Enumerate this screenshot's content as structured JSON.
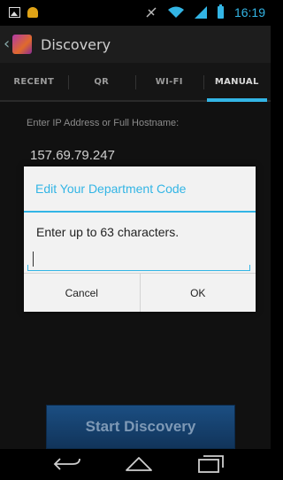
{
  "status_bar": {
    "time": "16:19",
    "icons": [
      "image-icon",
      "android-icon",
      "no-sync-icon",
      "wifi-icon",
      "signal-icon",
      "battery-icon"
    ],
    "accent_color": "#33b5e5"
  },
  "action_bar": {
    "title": "Discovery"
  },
  "tabs": [
    {
      "label": "RECENT",
      "active": false
    },
    {
      "label": "QR",
      "active": false
    },
    {
      "label": "WI-FI",
      "active": false
    },
    {
      "label": "MANUAL",
      "active": true
    }
  ],
  "manual": {
    "ip_label": "Enter IP Address or Full Hostname:",
    "ip_value": "157.69.79.247",
    "start_button": "Start Discovery"
  },
  "dialog": {
    "title": "Edit Your Department Code",
    "message": "Enter up to 63 characters.",
    "input_value": "",
    "cancel_label": "Cancel",
    "ok_label": "OK"
  },
  "nav_bar": {
    "icons": [
      "back-icon",
      "home-icon",
      "recent-apps-icon"
    ]
  }
}
